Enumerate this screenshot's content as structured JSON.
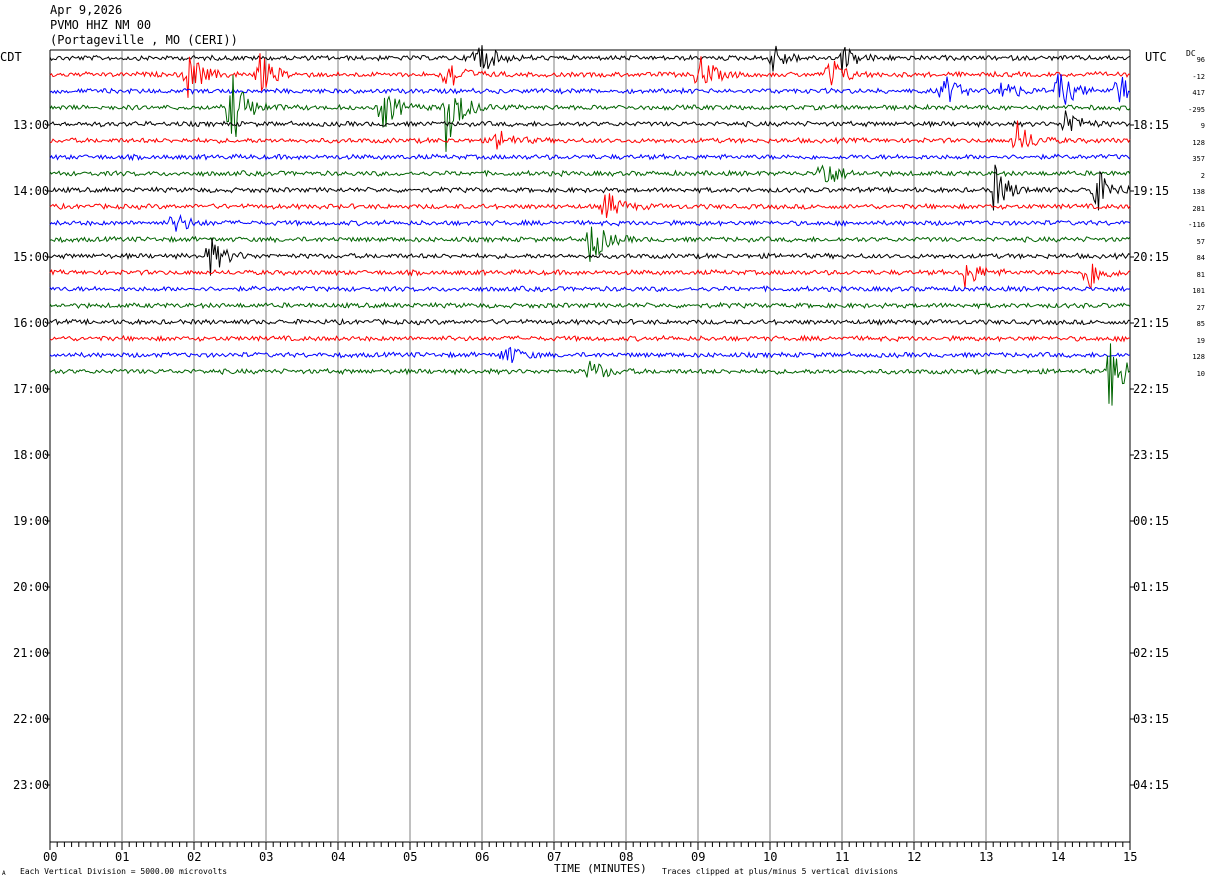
{
  "header": {
    "date": "Apr 9,2026",
    "station": "PVMO HHZ NM 00",
    "location": "(Portageville , MO (CERI))"
  },
  "timezones": {
    "left": "CDT",
    "right": "UTC"
  },
  "dc_label": "DC",
  "footer": {
    "scale_note": "Each Vertical Division = 5000.00 microvolts",
    "xlabel": "TIME (MINUTES)",
    "clip_note": "Traces clipped at plus/minus 5 vertical divisions",
    "corner_mark": "A"
  },
  "colors": {
    "trace_cycle": [
      "#000000",
      "#ff0000",
      "#0000ff",
      "#006400"
    ],
    "grid": "#808080"
  },
  "chart_data": {
    "type": "line",
    "title": "PVMO HHZ NM 00",
    "xlabel": "TIME (MINUTES)",
    "xlim": [
      0,
      15
    ],
    "x_ticks": [
      "00",
      "01",
      "02",
      "03",
      "04",
      "05",
      "06",
      "07",
      "08",
      "09",
      "10",
      "11",
      "12",
      "13",
      "14",
      "15"
    ],
    "left_hour_labels": [
      "13:00",
      "14:00",
      "15:00",
      "16:00",
      "17:00",
      "18:00",
      "19:00",
      "20:00",
      "21:00",
      "22:00",
      "23:00"
    ],
    "right_hour_labels": [
      "18:15",
      "19:15",
      "20:15",
      "21:15",
      "22:15",
      "23:15",
      "00:15",
      "01:15",
      "02:15",
      "03:15",
      "04:15"
    ],
    "trace_count": 20,
    "dc_offsets": [
      "96",
      "-12",
      "417",
      "-295",
      "9",
      "128",
      "357",
      "2",
      "138",
      "281",
      "-116",
      "57",
      "84",
      "81",
      "101",
      "27",
      "85",
      "19",
      "128",
      "10"
    ],
    "events": [
      {
        "trace": 0,
        "minute": 5.9,
        "amplitude": 3.0
      },
      {
        "trace": 0,
        "minute": 10.0,
        "amplitude": 2.0
      },
      {
        "trace": 0,
        "minute": 11.0,
        "amplitude": 1.5
      },
      {
        "trace": 1,
        "minute": 1.9,
        "amplitude": 3.0
      },
      {
        "trace": 1,
        "minute": 2.9,
        "amplitude": 2.5
      },
      {
        "trace": 1,
        "minute": 5.5,
        "amplitude": 2.5
      },
      {
        "trace": 1,
        "minute": 9.0,
        "amplitude": 2.5
      },
      {
        "trace": 1,
        "minute": 10.8,
        "amplitude": 2.5
      },
      {
        "trace": 2,
        "minute": 12.4,
        "amplitude": 2.0
      },
      {
        "trace": 2,
        "minute": 13.2,
        "amplitude": 1.5
      },
      {
        "trace": 2,
        "minute": 14.0,
        "amplitude": 2.5
      },
      {
        "trace": 2,
        "minute": 14.8,
        "amplitude": 2.5
      },
      {
        "trace": 3,
        "minute": 2.5,
        "amplitude": 5.0
      },
      {
        "trace": 3,
        "minute": 5.5,
        "amplitude": 5.0
      },
      {
        "trace": 3,
        "minute": 4.6,
        "amplitude": 3.0
      },
      {
        "trace": 4,
        "minute": 14.1,
        "amplitude": 2.0
      },
      {
        "trace": 5,
        "minute": 13.4,
        "amplitude": 2.5
      },
      {
        "trace": 5,
        "minute": 6.2,
        "amplitude": 1.5
      },
      {
        "trace": 7,
        "minute": 10.7,
        "amplitude": 2.5
      },
      {
        "trace": 8,
        "minute": 13.1,
        "amplitude": 3.0
      },
      {
        "trace": 8,
        "minute": 14.5,
        "amplitude": 3.0
      },
      {
        "trace": 9,
        "minute": 7.7,
        "amplitude": 2.0
      },
      {
        "trace": 10,
        "minute": 1.7,
        "amplitude": 1.5
      },
      {
        "trace": 11,
        "minute": 7.5,
        "amplitude": 3.0
      },
      {
        "trace": 12,
        "minute": 2.2,
        "amplitude": 2.5
      },
      {
        "trace": 13,
        "minute": 12.7,
        "amplitude": 2.0
      },
      {
        "trace": 13,
        "minute": 14.4,
        "amplitude": 2.5
      },
      {
        "trace": 18,
        "minute": 6.3,
        "amplitude": 1.5
      },
      {
        "trace": 19,
        "minute": 7.5,
        "amplitude": 1.5
      },
      {
        "trace": 19,
        "minute": 14.7,
        "amplitude": 5.0
      }
    ]
  }
}
